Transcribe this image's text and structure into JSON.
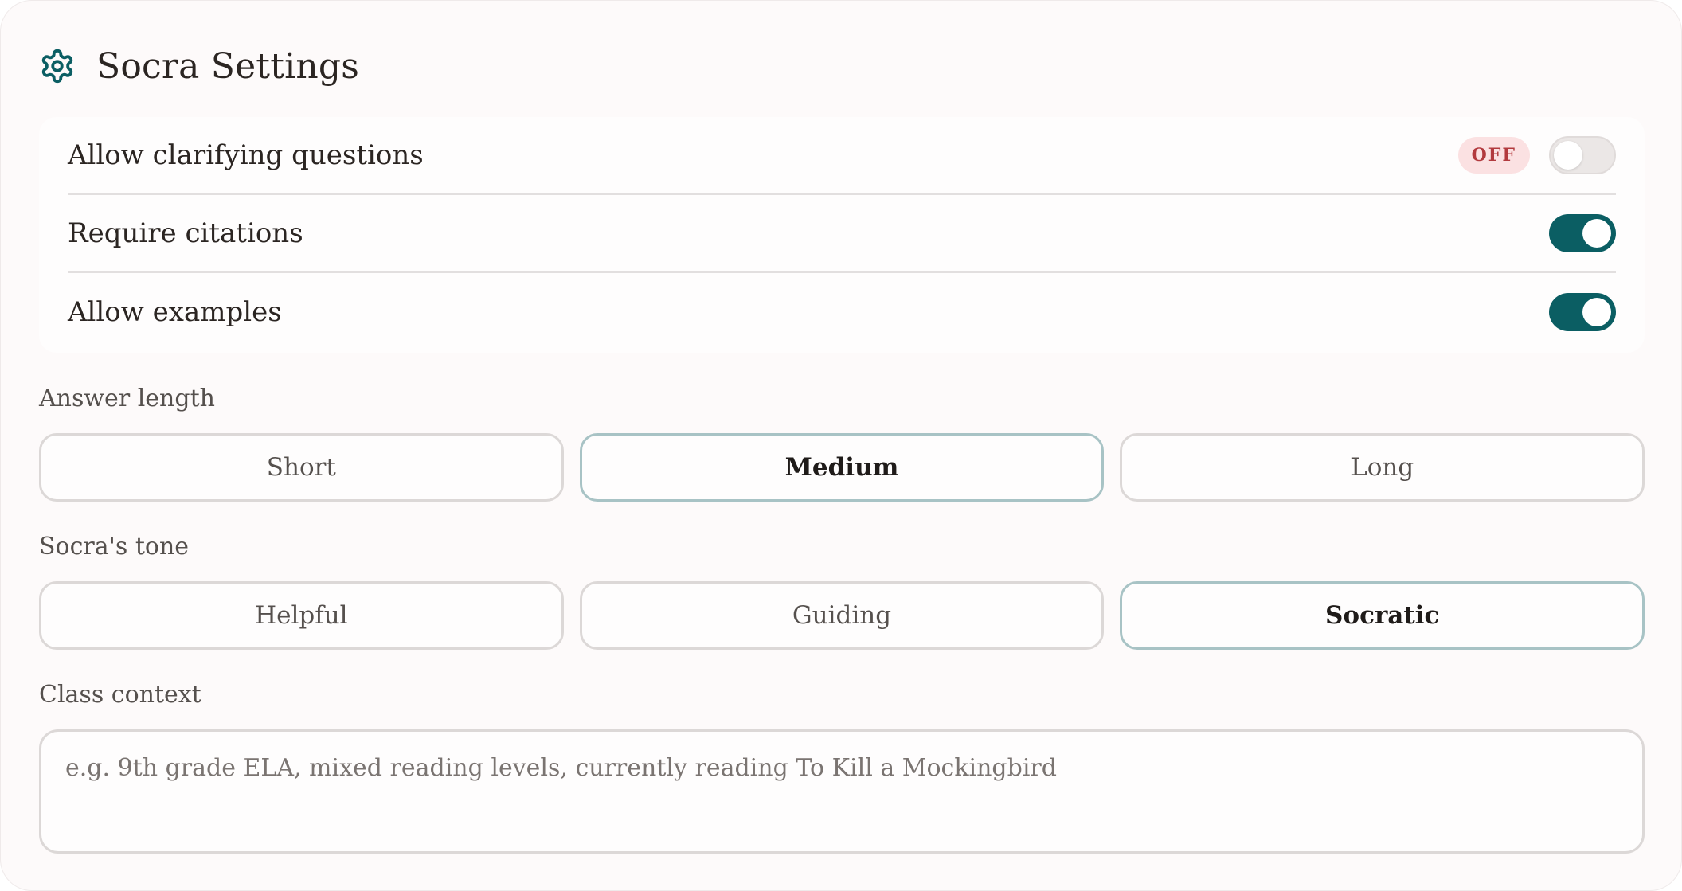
{
  "header": {
    "icon": "gear-icon",
    "title": "Socra Settings",
    "accent_color": "#0b5e63"
  },
  "toggles": [
    {
      "label": "Allow clarifying questions",
      "state": "off",
      "badge": "OFF"
    },
    {
      "label": "Require citations",
      "state": "on"
    },
    {
      "label": "Allow examples",
      "state": "on"
    }
  ],
  "answer_length": {
    "label": "Answer length",
    "options": [
      "Short",
      "Medium",
      "Long"
    ],
    "selected": "Medium"
  },
  "tone": {
    "label": "Socra's tone",
    "options": [
      "Helpful",
      "Guiding",
      "Socratic"
    ],
    "selected": "Socratic"
  },
  "class_context": {
    "label": "Class context",
    "value": "",
    "placeholder": "e.g. 9th grade ELA, mixed reading levels, currently reading To Kill a Mockingbird"
  }
}
